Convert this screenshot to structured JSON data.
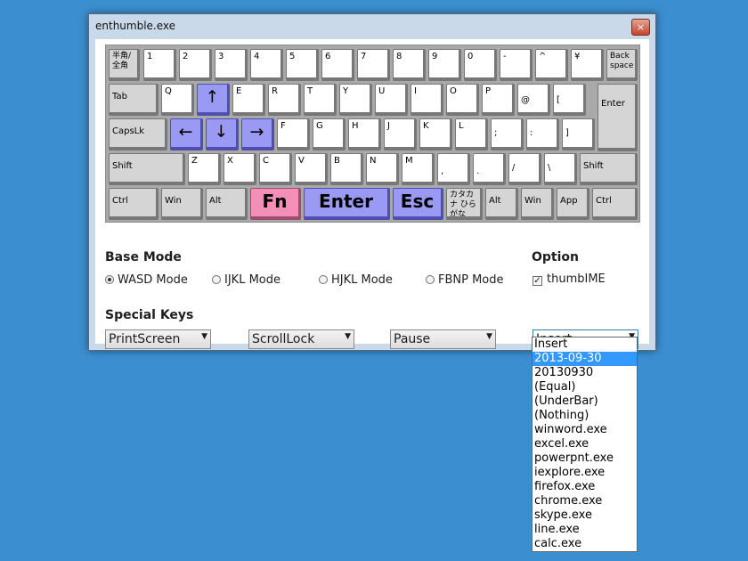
{
  "window": {
    "title": "enthumble.exe",
    "close_glyph": "×"
  },
  "keyboard": {
    "row1": [
      "半角/全角",
      "1",
      "2",
      "3",
      "4",
      "5",
      "6",
      "7",
      "8",
      "9",
      "0",
      "-",
      "^",
      "¥",
      "Back space"
    ],
    "row2": [
      "Tab",
      "Q",
      "↑",
      "E",
      "R",
      "T",
      "Y",
      "U",
      "I",
      "O",
      "P",
      "@",
      "[",
      "Enter"
    ],
    "row3": [
      "CapsLk",
      "←",
      "↓",
      "→",
      "F",
      "G",
      "H",
      "J",
      "K",
      "L",
      ";",
      ":",
      "]"
    ],
    "row4": [
      "Shift",
      "Z",
      "X",
      "C",
      "V",
      "B",
      "N",
      "M",
      ",",
      ".",
      "/",
      "\\",
      "Shift"
    ],
    "row5": [
      "Ctrl",
      "Win",
      "Alt",
      "Fn",
      "Enter",
      "Esc",
      "カタカナ ひらがな",
      "Alt",
      "Win",
      "App",
      "Ctrl"
    ]
  },
  "base_mode": {
    "label": "Base Mode",
    "options": [
      "WASD Mode",
      "IJKL Mode",
      "HJKL Mode",
      "FBNP Mode"
    ],
    "selected": "WASD Mode"
  },
  "option": {
    "label": "Option",
    "checkbox_label": "thumbIME",
    "checked": true
  },
  "special_keys": {
    "label": "Special Keys",
    "combos": [
      "PrintScreen",
      "ScrollLock",
      "Pause",
      "Insert"
    ]
  },
  "dropdown": {
    "items": [
      "Insert",
      "2013-09-30",
      "20130930",
      "(Equal)",
      "(UnderBar)",
      "(Nothing)",
      "winword.exe",
      "excel.exe",
      "powerpnt.exe",
      "iexplore.exe",
      "firefox.exe",
      "chrome.exe",
      "skype.exe",
      "line.exe",
      "calc.exe"
    ],
    "highlighted": "2013-09-30"
  },
  "colors": {
    "arrow_keys": "#9a9af4",
    "fn_key": "#f48fb8",
    "desktop": "#3b8fd0",
    "highlight": "#3399ff"
  }
}
